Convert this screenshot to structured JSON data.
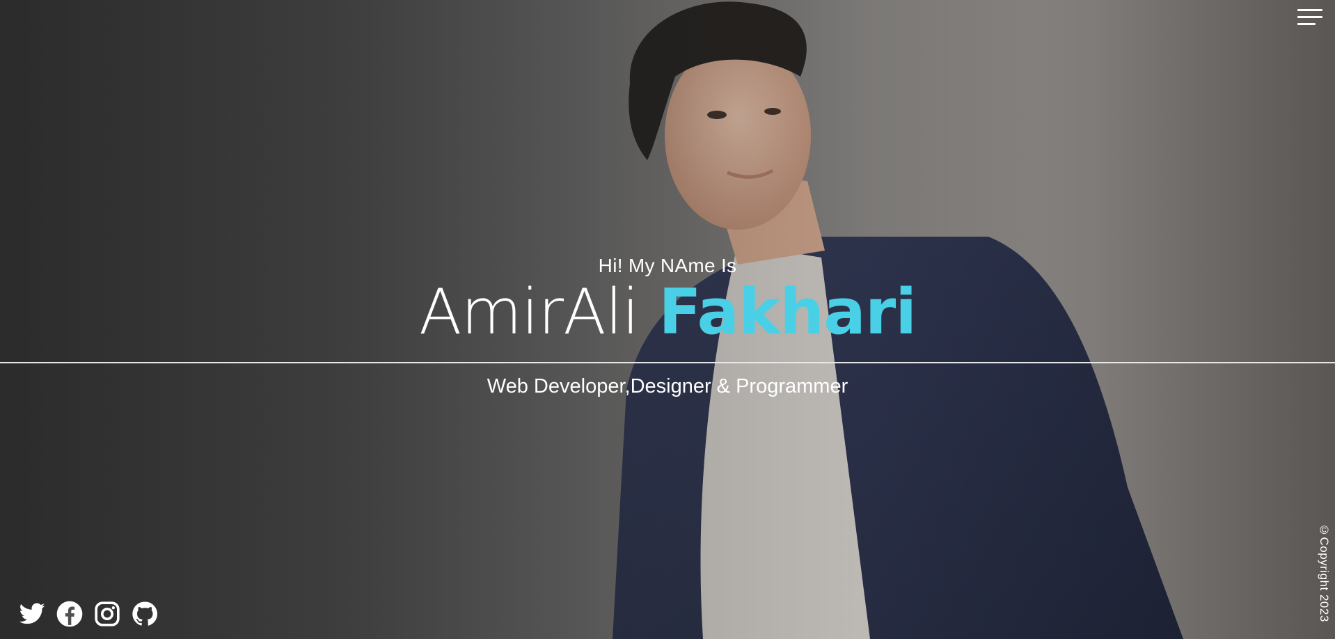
{
  "header": {
    "menu_icon": "hamburger-menu-icon"
  },
  "intro": {
    "greeting": "Hi! My NAme Is",
    "first_name": "AmirAli",
    "last_name": "Fakhari",
    "role": "Web Developer,Designer & Programmer"
  },
  "socials": [
    {
      "icon": "twitter-icon"
    },
    {
      "icon": "facebook-icon"
    },
    {
      "icon": "instagram-icon"
    },
    {
      "icon": "github-icon"
    }
  ],
  "footer": {
    "copyright": "©Copyright 2023"
  },
  "colors": {
    "accent": "#4ad0e6",
    "text": "#ffffff"
  }
}
